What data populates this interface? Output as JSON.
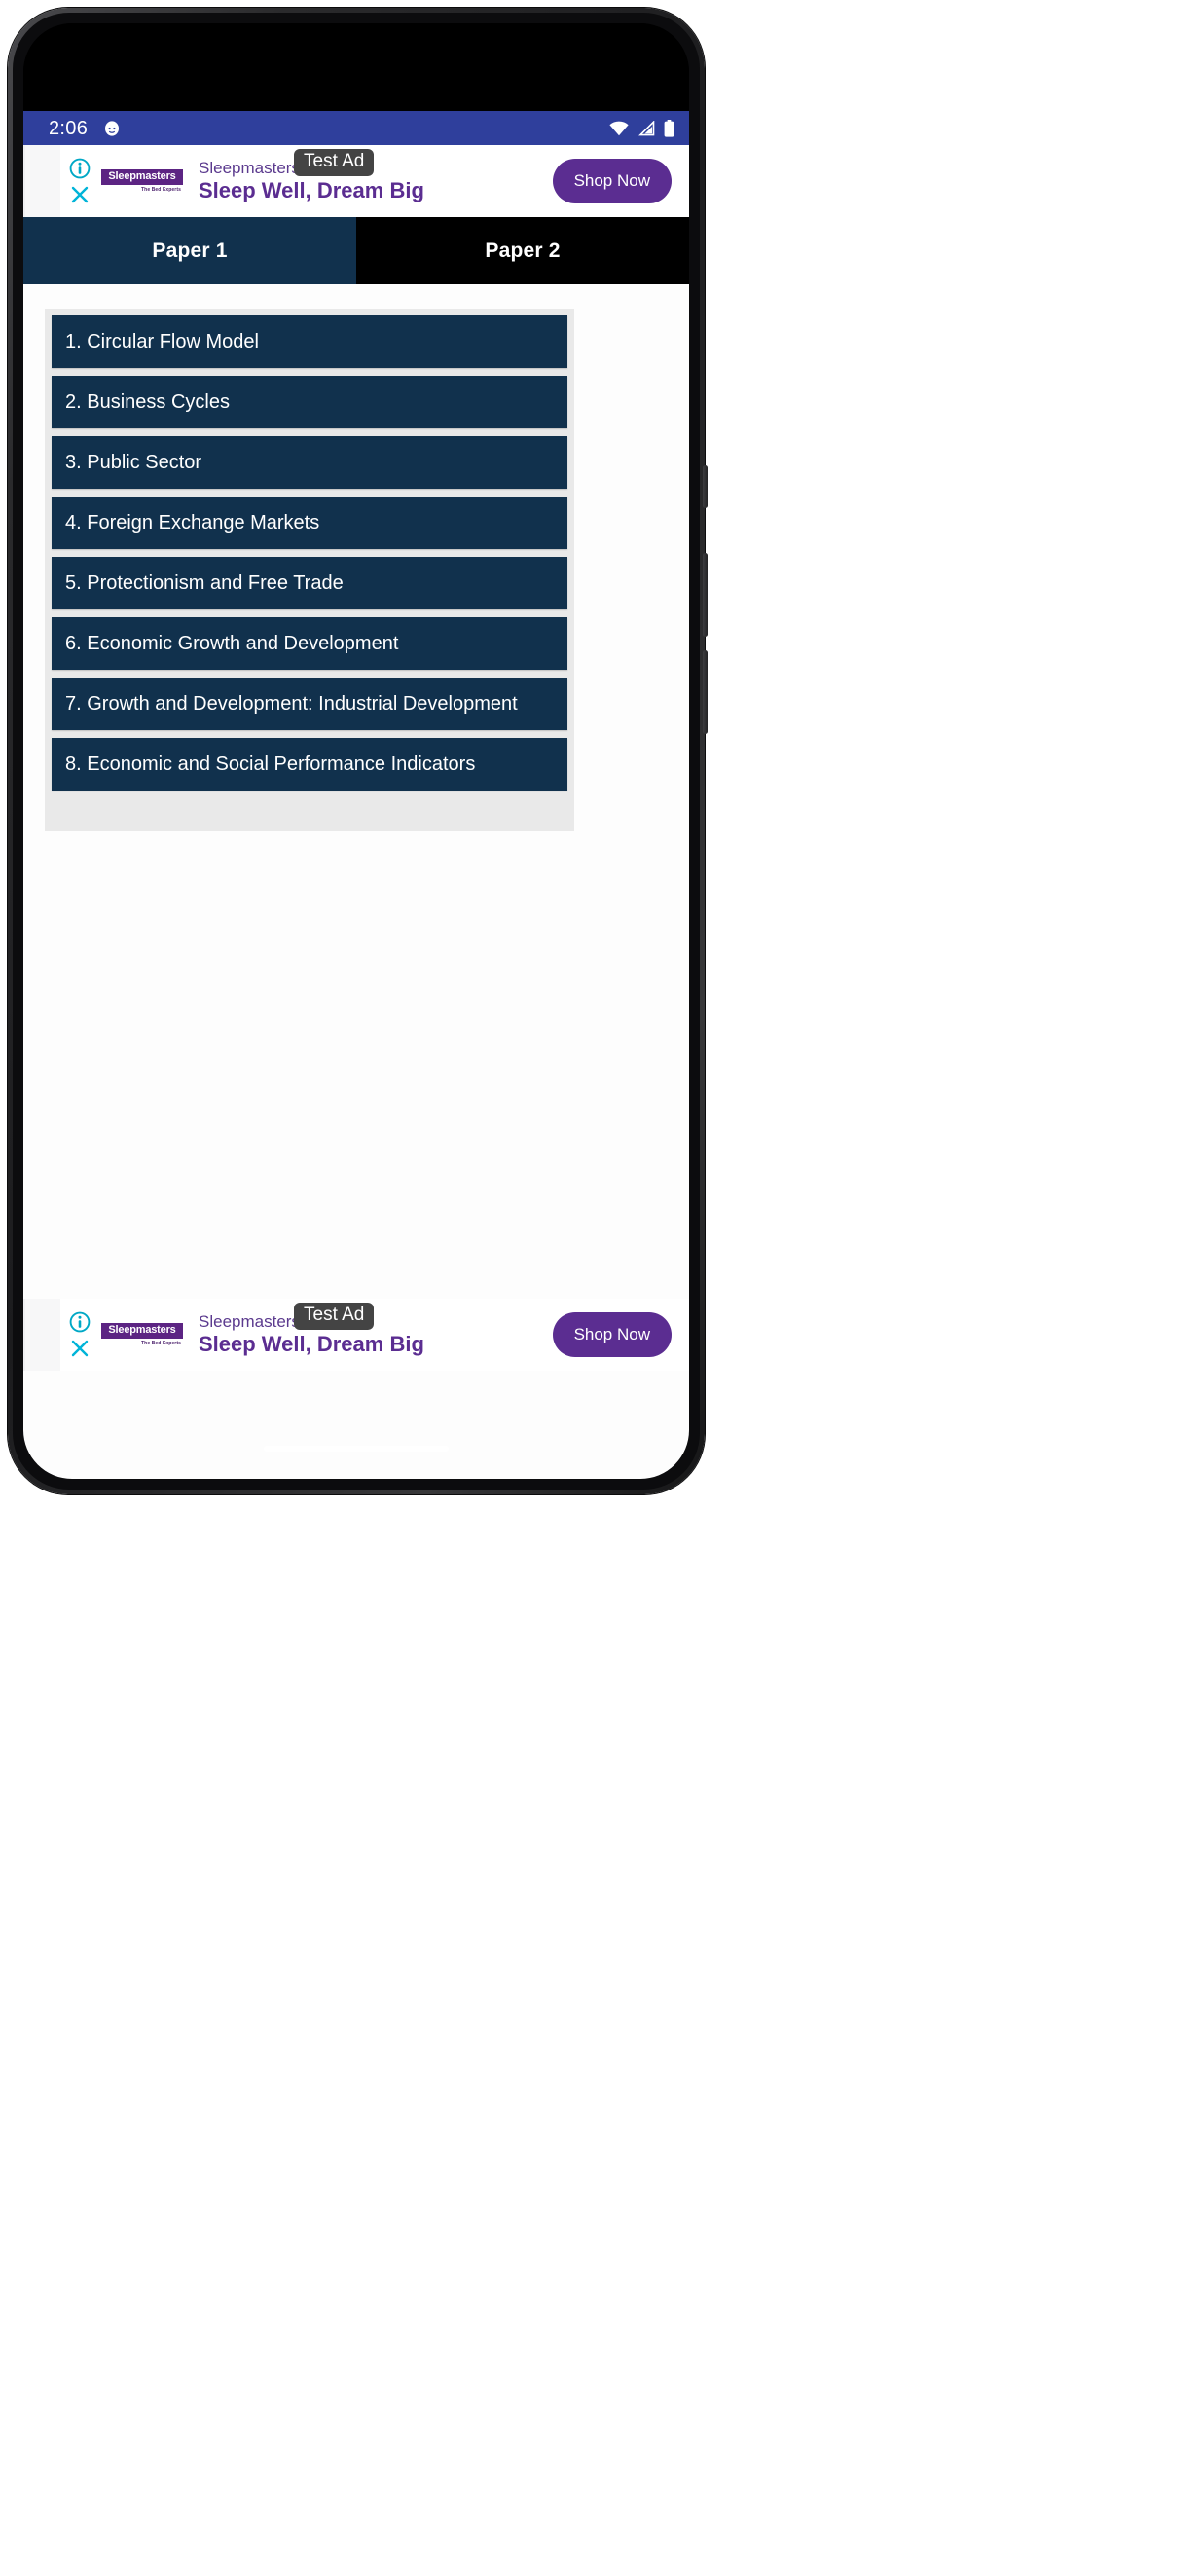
{
  "status_bar": {
    "time": "2:06",
    "notification_icon": "app-notification-icon",
    "wifi_icon": "wifi-icon",
    "signal_icon": "cellular-signal-icon",
    "battery_icon": "battery-icon",
    "background_color": "#2f3f9c"
  },
  "ad_top": {
    "test_badge": "Test Ad",
    "advertiser": "Sleepmasters",
    "headline": "Sleep Well, Dream Big",
    "cta_label": "Shop Now",
    "logo_text": "Sleepmasters",
    "logo_tagline": "The Bed Experts",
    "info_icon": "ad-info-icon",
    "close_icon": "ad-close-icon",
    "brand_color": "#5b2d91"
  },
  "ad_bottom": {
    "test_badge": "Test Ad",
    "advertiser": "Sleepmasters",
    "headline": "Sleep Well, Dream Big",
    "cta_label": "Shop Now",
    "logo_text": "Sleepmasters",
    "logo_tagline": "The Bed Experts",
    "info_icon": "ad-info-icon",
    "close_icon": "ad-close-icon",
    "brand_color": "#5b2d91"
  },
  "tabs": [
    {
      "label": "Paper 1",
      "selected": true
    },
    {
      "label": "Paper 2",
      "selected": false
    }
  ],
  "topics": [
    {
      "label": "1. Circular Flow Model"
    },
    {
      "label": "2. Business Cycles"
    },
    {
      "label": "3. Public Sector"
    },
    {
      "label": "4. Foreign Exchange Markets"
    },
    {
      "label": "5. Protectionism and Free Trade"
    },
    {
      "label": "6. Economic Growth and Development"
    },
    {
      "label": "7. Growth and Development: Industrial Development"
    },
    {
      "label": "8. Economic and Social Performance Indicators"
    }
  ],
  "theme": {
    "navy": "#11314d",
    "list_background": "#e9e9e9",
    "page_background": "#fdfdfd"
  }
}
